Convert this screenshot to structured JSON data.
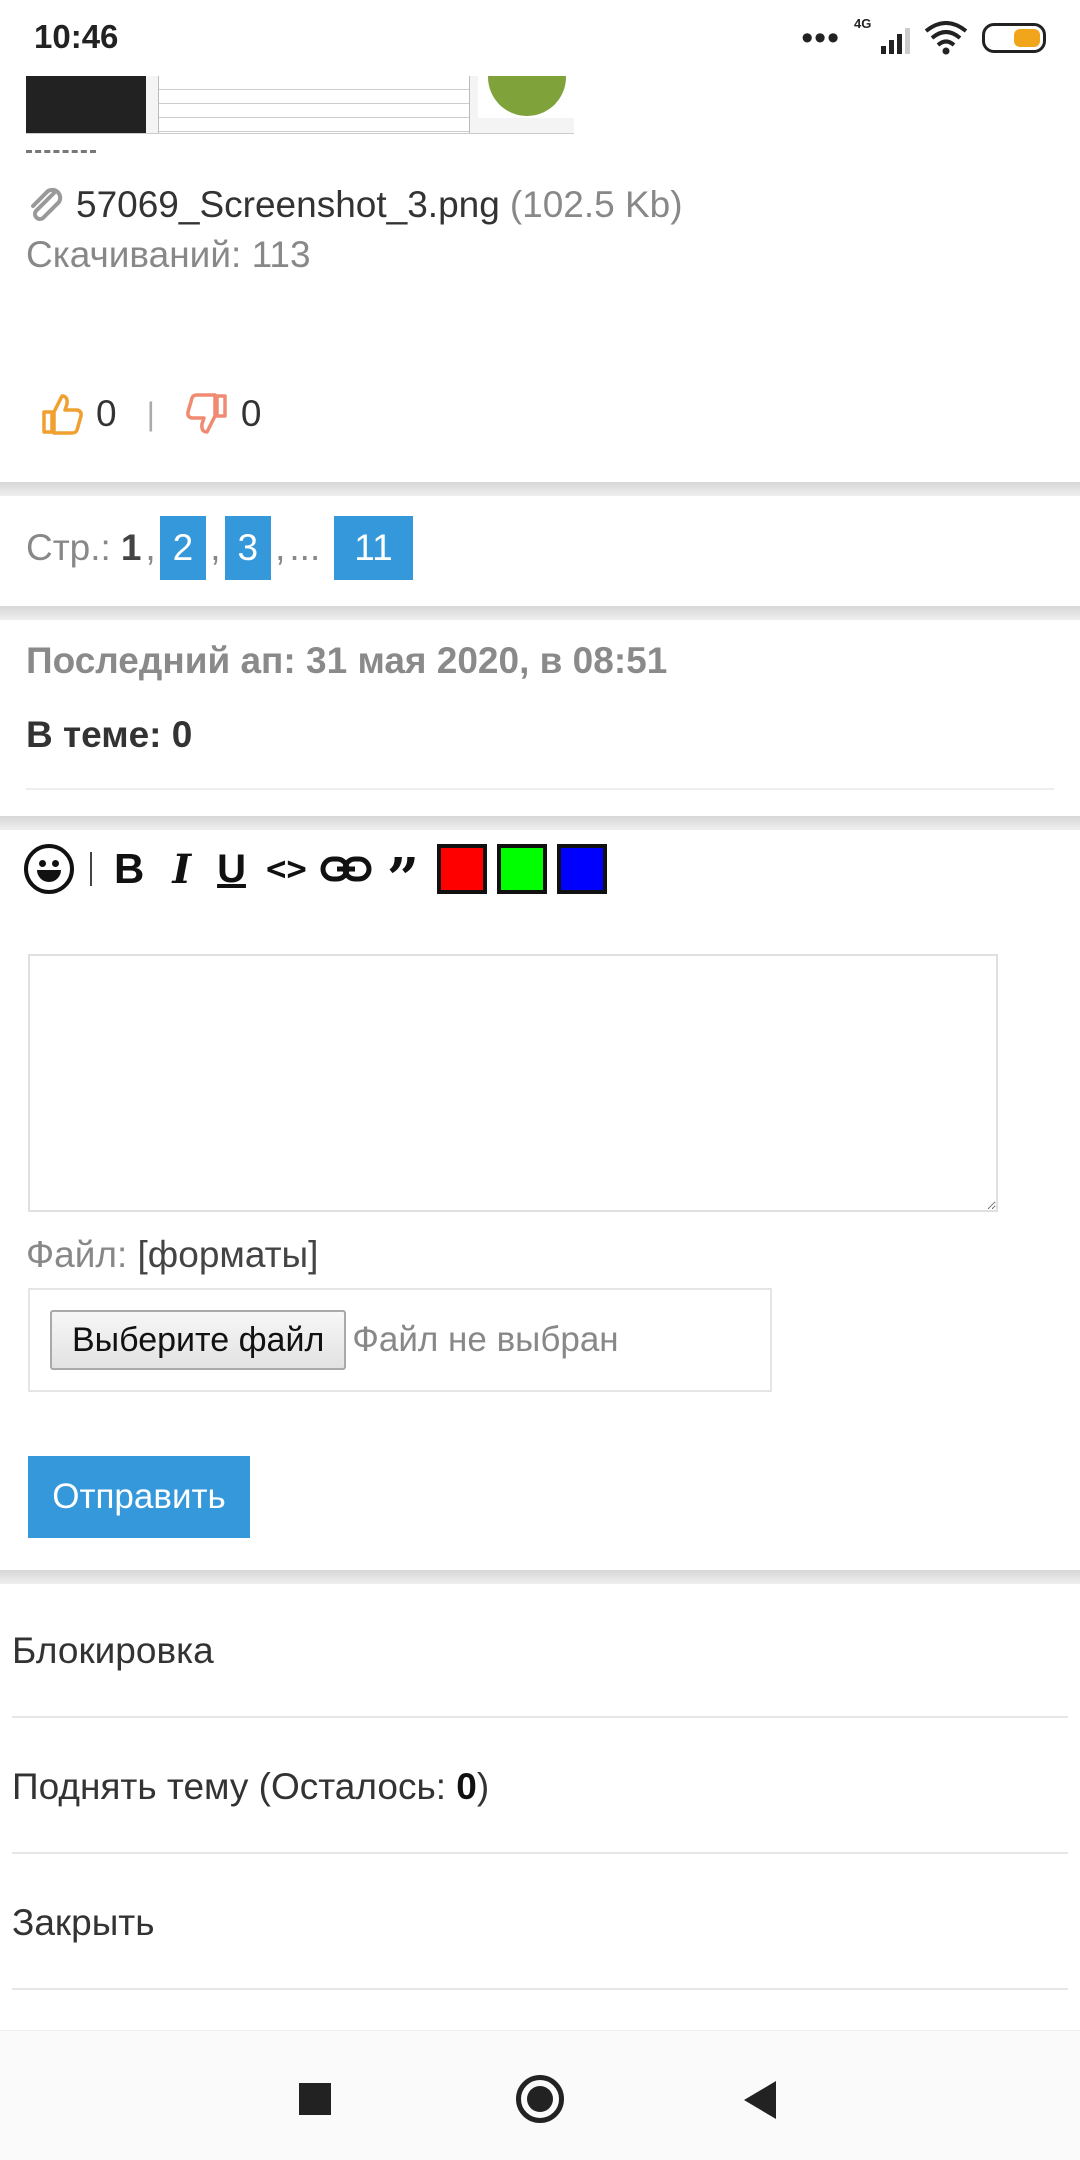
{
  "status_bar": {
    "time": "10:46",
    "network_label": "4G"
  },
  "attachment": {
    "file_name": "57069_Screenshot_3.png",
    "file_size": "(102.5 Kb)",
    "downloads": "Скачиваний: 113"
  },
  "votes": {
    "likes": "0",
    "separator": "|",
    "dislikes": "0"
  },
  "pager": {
    "label": "Стр.:",
    "current": "1",
    "pages": [
      "2",
      "3",
      "11"
    ],
    "ellipsis": "..."
  },
  "topic_info": {
    "last_update": "Последний ап: 31 мая 2020, в 08:51",
    "in_topic": "В теме: 0"
  },
  "editor": {
    "toolbar": {
      "bold": "B",
      "italic": "I",
      "underline": "U",
      "code": "<>",
      "quote": "”",
      "colors": [
        "#ff0000",
        "#00ff00",
        "#0000ff"
      ]
    },
    "message_value": "",
    "file_label": "Файл:",
    "formats_link": "[форматы]",
    "choose_file": "Выберите файл",
    "no_file": "Файл не выбран",
    "submit": "Отправить"
  },
  "menu": {
    "lock": "Блокировка",
    "raise_prefix": "Поднять тему (Осталось: ",
    "raise_count": "0",
    "raise_suffix": ")",
    "close": "Закрыть"
  },
  "colors": {
    "accent": "#3498db",
    "like": "#f0a030",
    "dislike": "#f08a70"
  }
}
